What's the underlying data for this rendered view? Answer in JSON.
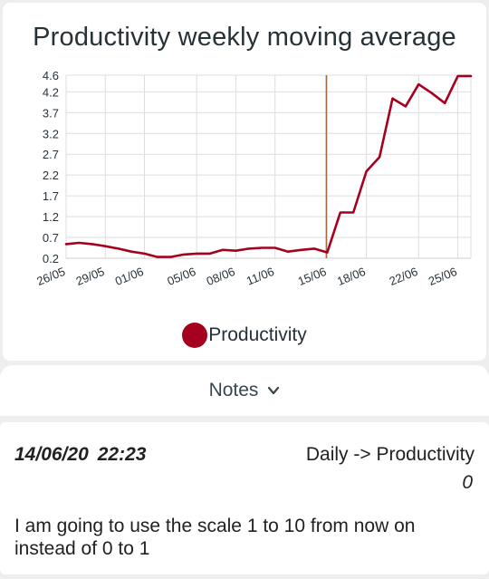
{
  "chart_data": {
    "type": "line",
    "title": "Productivity weekly moving average",
    "x": [
      "26/05",
      "27/05",
      "28/05",
      "29/05",
      "30/05",
      "31/05",
      "01/06",
      "02/06",
      "03/06",
      "04/06",
      "05/06",
      "06/06",
      "07/06",
      "08/06",
      "09/06",
      "10/06",
      "11/06",
      "12/06",
      "13/06",
      "14/06",
      "15/06",
      "16/06",
      "17/06",
      "18/06",
      "19/06",
      "20/06",
      "21/06",
      "22/06",
      "23/06",
      "24/06",
      "25/06",
      "26/06"
    ],
    "x_tick_labels": [
      "26/05",
      "29/05",
      "01/06",
      "05/06",
      "08/06",
      "11/06",
      "15/06",
      "18/06",
      "22/06",
      "25/06"
    ],
    "y_tick_labels": [
      "0.2",
      "0.7",
      "1.2",
      "1.7",
      "2.2",
      "2.7",
      "3.2",
      "3.7",
      "4.2",
      "4.6"
    ],
    "ylim": [
      0.2,
      4.6
    ],
    "series": [
      {
        "name": "Productivity",
        "color": "#a5001e",
        "values": [
          0.54,
          0.57,
          0.54,
          0.49,
          0.43,
          0.36,
          0.31,
          0.23,
          0.23,
          0.29,
          0.31,
          0.31,
          0.4,
          0.38,
          0.43,
          0.45,
          0.45,
          0.36,
          0.4,
          0.43,
          0.34,
          1.3,
          1.3,
          2.29,
          2.63,
          4.04,
          3.85,
          4.38,
          4.17,
          3.93,
          4.58,
          4.58
        ]
      }
    ],
    "marker_line_x": "15/06",
    "marker_line_color": "#9e6b4a",
    "grid": true,
    "legend": "bottom-center"
  },
  "notes": {
    "label": "Notes",
    "icon": "chevron-down-icon"
  },
  "note": {
    "date": "14/06/20",
    "time": "22:23",
    "category": "Daily -> Productivity",
    "value": "0",
    "text": "I am going to use the scale 1 to 10 from now on instead of 0 to 1"
  }
}
